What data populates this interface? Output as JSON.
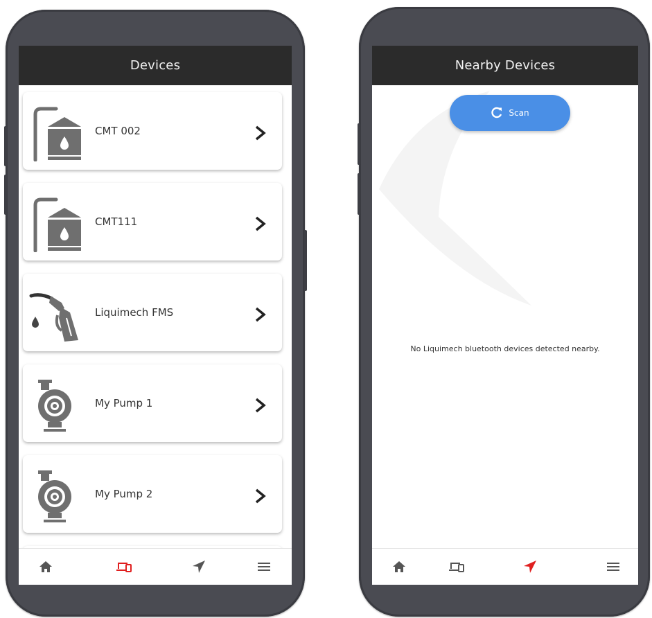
{
  "colors": {
    "appbar_bg": "#2b2b2b",
    "active_nav": "#e02020",
    "inactive_nav": "#555555",
    "scan_button": "#4a8fe6",
    "device_icon": "#6f6f6f"
  },
  "devices_screen": {
    "title": "Devices",
    "items": [
      {
        "label": "CMT 002",
        "icon": "fuel-tank-icon"
      },
      {
        "label": "CMT111",
        "icon": "fuel-tank-icon"
      },
      {
        "label": "Liquimech FMS",
        "icon": "fuel-nozzle-icon"
      },
      {
        "label": "My Pump 1",
        "icon": "pump-icon"
      },
      {
        "label": "My Pump 2",
        "icon": "pump-icon"
      }
    ],
    "nav": {
      "items": [
        "home-icon",
        "devices-icon",
        "nearby-icon",
        "menu-icon"
      ],
      "active": "devices-icon"
    }
  },
  "nearby_screen": {
    "title": "Nearby Devices",
    "scan_label": "Scan",
    "empty_message": "No Liquimech bluetooth devices detected nearby.",
    "nav": {
      "items": [
        "home-icon",
        "devices-icon",
        "nearby-icon",
        "menu-icon"
      ],
      "active": "nearby-icon"
    }
  }
}
